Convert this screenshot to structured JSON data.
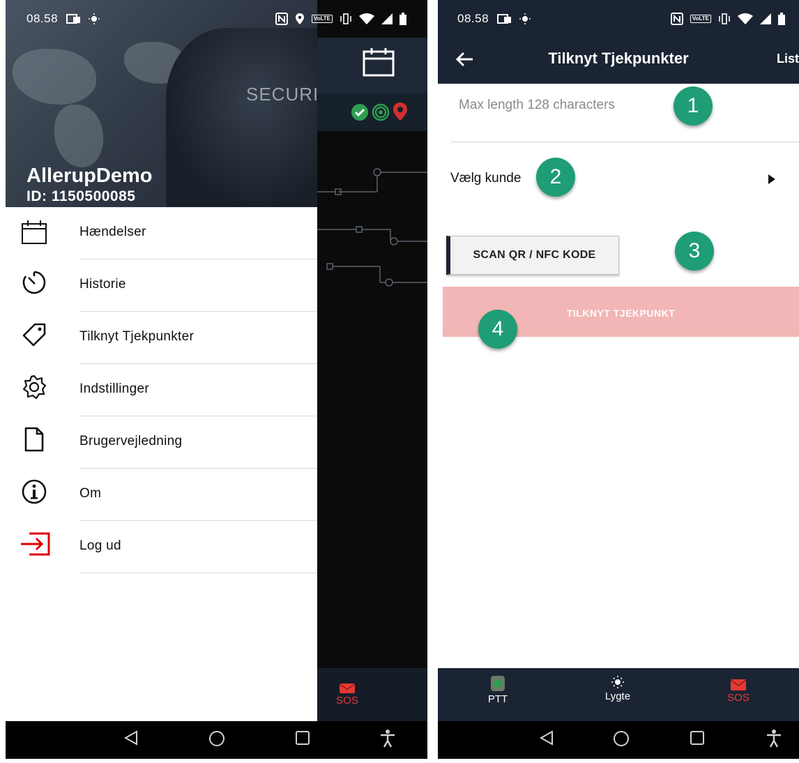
{
  "left_phone": {
    "status_bar": {
      "time": "08.58",
      "volte": "VoLTE"
    },
    "drawer": {
      "header": {
        "watermark": "SECURI",
        "account_name": "AllerupDemo",
        "account_id": "ID: 1150500085"
      },
      "items": [
        {
          "label": "Hændelser",
          "icon": "calendar-icon"
        },
        {
          "label": "Historie",
          "icon": "timer-icon"
        },
        {
          "label": "Tilknyt Tjekpunkter",
          "icon": "tag-icon"
        },
        {
          "label": "Indstillinger",
          "icon": "gear-icon"
        },
        {
          "label": "Brugervejledning",
          "icon": "document-icon"
        },
        {
          "label": "Om",
          "icon": "info-icon"
        },
        {
          "label": "Log ud",
          "icon": "logout-icon",
          "color": "#e00000"
        }
      ]
    },
    "background_app": {
      "sos_label": "SOS"
    }
  },
  "right_phone": {
    "status_bar": {
      "time": "08.58",
      "volte": "VoLTE"
    },
    "toolbar": {
      "title": "Tilknyt Tjekpunkter",
      "action": "List"
    },
    "name_input": {
      "placeholder": "Max length 128 characters"
    },
    "customer_select": {
      "label": "Vælg kunde"
    },
    "scan_button": {
      "label": "SCAN QR / NFC KODE"
    },
    "attach_button": {
      "label": "TILKNYT TJEKPUNKT",
      "color": "#f2b6b6"
    },
    "badges": [
      "1",
      "2",
      "3",
      "4"
    ],
    "bottom_bar": [
      {
        "label": "PTT",
        "icon": "ptt-icon"
      },
      {
        "label": "Lygte",
        "icon": "flashlight-icon"
      },
      {
        "label": "SOS",
        "icon": "mail-icon",
        "color": "#e53935"
      }
    ]
  },
  "colors": {
    "navy": "#1b2433",
    "accent_green": "#1f9d77",
    "sos_red": "#e53935"
  }
}
